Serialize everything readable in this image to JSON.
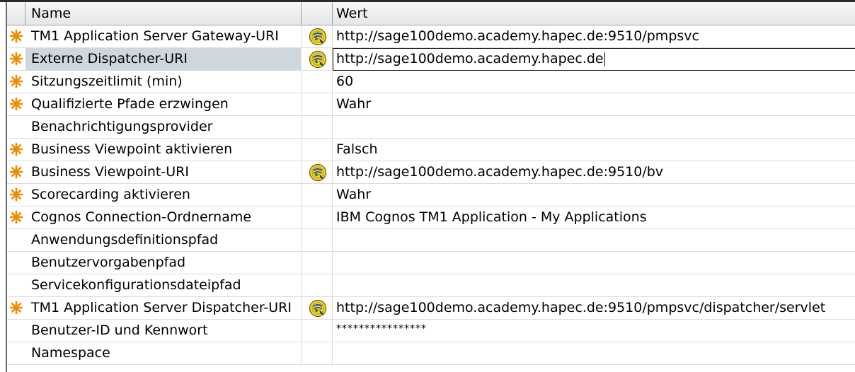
{
  "header": {
    "name": "Name",
    "value": "Wert"
  },
  "rows": [
    {
      "name": "TM1 Application Server Gateway-URI",
      "value": "http://sage100demo.academy.hapec.de:9510/pmpsvc",
      "required": true,
      "icon": "uri-icon"
    },
    {
      "name": "Externe Dispatcher-URI",
      "value": "http://sage100demo.academy.hapec.de",
      "required": true,
      "icon": "uri-icon",
      "editing": true
    },
    {
      "name": "Sitzungszeitlimit (min)",
      "value": "60",
      "required": true
    },
    {
      "name": "Qualifizierte Pfade erzwingen",
      "value": "Wahr",
      "required": true
    },
    {
      "name": "Benachrichtigungsprovider",
      "value": "",
      "required": false
    },
    {
      "name": "Business Viewpoint aktivieren",
      "value": "Falsch",
      "required": true
    },
    {
      "name": "Business Viewpoint-URI",
      "value": "http://sage100demo.academy.hapec.de:9510/bv",
      "required": true,
      "icon": "uri-icon"
    },
    {
      "name": "Scorecarding aktivieren",
      "value": "Wahr",
      "required": true
    },
    {
      "name": "Cognos Connection-Ordnername",
      "value": "IBM Cognos TM1 Application - My Applications",
      "required": true
    },
    {
      "name": "Anwendungsdefinitionspfad",
      "value": "",
      "required": false
    },
    {
      "name": "Benutzervorgabenpfad",
      "value": "",
      "required": false
    },
    {
      "name": "Servicekonfigurationsdateipfad",
      "value": "",
      "required": false
    },
    {
      "name": "TM1 Application Server Dispatcher-URI",
      "value": "http://sage100demo.academy.hapec.de:9510/pmpsvc/dispatcher/servlet",
      "required": true,
      "icon": "uri-icon"
    },
    {
      "name": "Benutzer-ID und Kennwort",
      "value": "****************",
      "required": false,
      "masked": true
    },
    {
      "name": "Namespace",
      "value": "",
      "required": false
    }
  ],
  "colors": {
    "required_star": "#f08a00",
    "selected_row": "#cfd7de"
  }
}
